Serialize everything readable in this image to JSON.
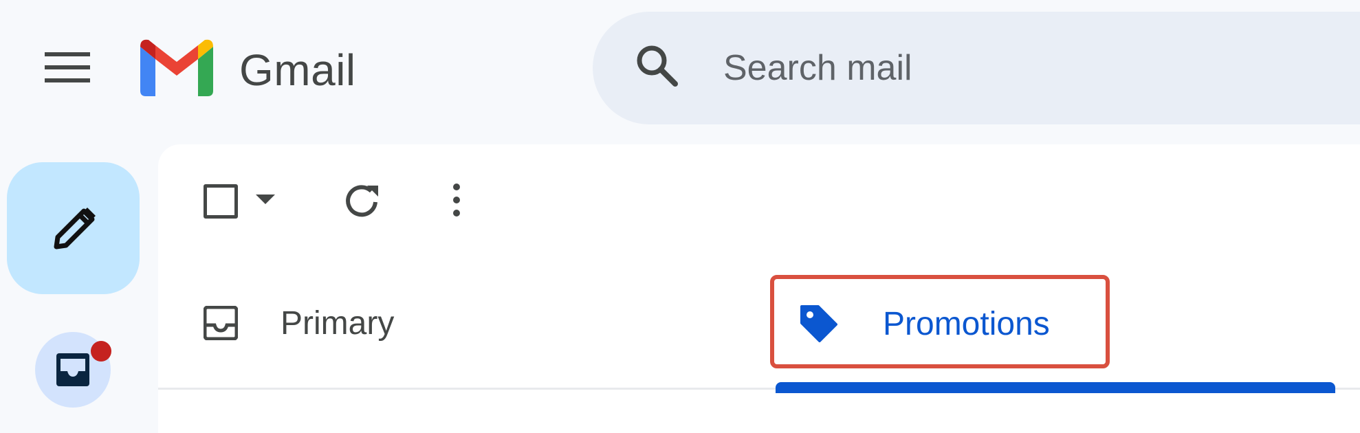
{
  "header": {
    "app_name": "Gmail",
    "search_placeholder": "Search mail"
  },
  "tabs": [
    {
      "label": "Primary",
      "icon": "inbox-icon",
      "selected": false
    },
    {
      "label": "Promotions",
      "icon": "tag-icon",
      "selected": true,
      "highlighted": true
    }
  ],
  "sidebar": {
    "inbox_has_notification": true
  },
  "colors": {
    "accent": "#0b57d0",
    "compose_bg": "#c2e7ff",
    "search_bg": "#e9eef6",
    "highlight_border": "#d9503f",
    "notification_dot": "#c5221f"
  }
}
